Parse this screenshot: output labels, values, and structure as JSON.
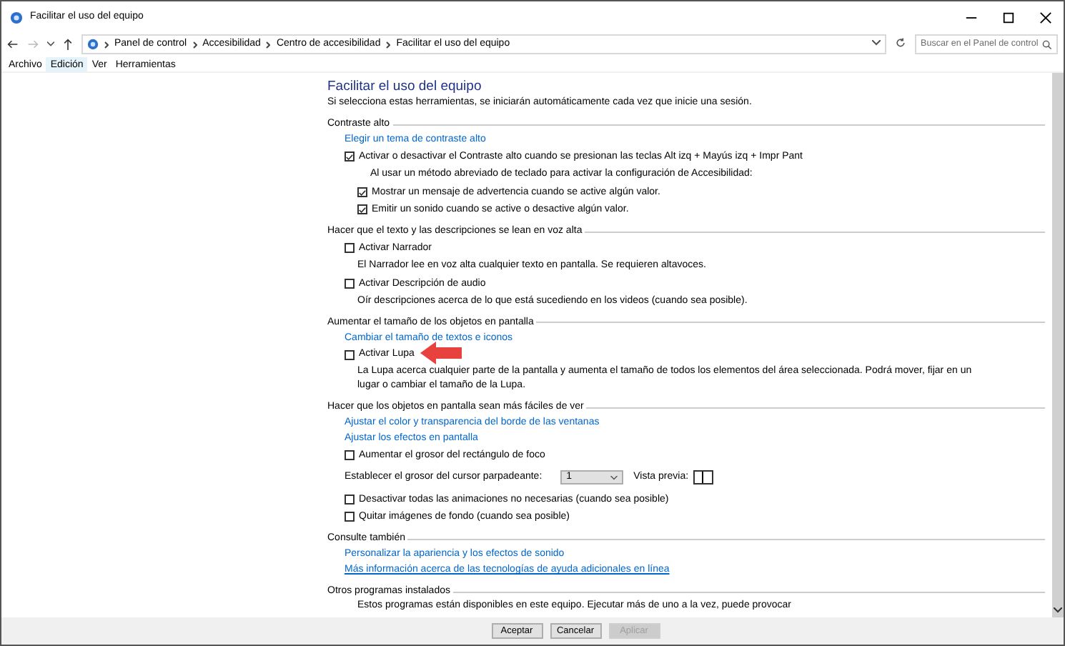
{
  "window": {
    "title": "Facilitar el uso del equipo"
  },
  "address": {
    "breadcrumb": [
      "Panel de control",
      "Accesibilidad",
      "Centro de accesibilidad",
      "Facilitar el uso del equipo"
    ],
    "search_placeholder": "Buscar en el Panel de control"
  },
  "menu": [
    {
      "label": "Archivo",
      "selected": false
    },
    {
      "label": "Edición",
      "selected": true
    },
    {
      "label": "Ver",
      "selected": false
    },
    {
      "label": "Herramientas",
      "selected": false
    }
  ],
  "page": {
    "title": "Facilitar el uso del equipo",
    "subtitle": "Si selecciona estas herramientas, se iniciarán automáticamente cada vez que inicie una sesión."
  },
  "sections": [
    {
      "heading": "Contraste alto",
      "items": [
        {
          "kind": "link",
          "label": "Elegir un tema de contraste alto"
        },
        {
          "kind": "check",
          "label": "Activar o desactivar el Contraste alto cuando se presionan las teclas Alt izq + Mayús izq + Impr Pant",
          "checked": true,
          "children": [
            {
              "kind": "text",
              "label": "Al usar un método abreviado de teclado para activar la configuración de Accesibilidad:"
            },
            {
              "kind": "check",
              "label": "Mostrar un mensaje de advertencia cuando se active algún valor.",
              "checked": true
            },
            {
              "kind": "check",
              "label": "Emitir un sonido cuando se active o desactive algún valor.",
              "checked": true
            }
          ]
        }
      ]
    },
    {
      "heading": "Hacer que el texto y las descripciones se lean en voz alta",
      "items": [
        {
          "kind": "check",
          "label": "Activar Narrador",
          "checked": false
        },
        {
          "kind": "text",
          "label": "El Narrador lee en voz alta cualquier texto en pantalla. Se requieren altavoces."
        },
        {
          "kind": "check",
          "label": "Activar Descripción de audio",
          "checked": false
        },
        {
          "kind": "text",
          "label": "Oír descripciones acerca de lo que está sucediendo en los videos (cuando sea posible)."
        }
      ]
    },
    {
      "heading": "Aumentar el tamaño de los objetos en pantalla",
      "items": [
        {
          "kind": "link",
          "label": "Cambiar el tamaño de textos e iconos"
        },
        {
          "kind": "check",
          "label": "Activar Lupa",
          "checked": false,
          "pointer": true
        },
        {
          "kind": "text",
          "label": "La Lupa acerca cualquier parte de la pantalla y aumenta el tamaño de todos los elementos del área seleccionada. Podrá mover, fijar en un lugar o cambiar el tamaño de la Lupa."
        }
      ]
    },
    {
      "heading": "Hacer que los objetos en pantalla sean más fáciles de ver",
      "items": [
        {
          "kind": "link",
          "label": "Ajustar el color y transparencia del borde de las ventanas"
        },
        {
          "kind": "link",
          "label": "Ajustar los efectos en pantalla"
        },
        {
          "kind": "check",
          "label": "Aumentar el grosor del rectángulo de foco",
          "checked": false
        },
        {
          "kind": "select",
          "label": "Establecer el grosor del cursor parpadeante:",
          "value": "1",
          "preview_label": "Vista previa:"
        },
        {
          "kind": "check",
          "label": "Desactivar todas las animaciones no necesarias (cuando sea posible)",
          "checked": false
        },
        {
          "kind": "check",
          "label": "Quitar imágenes de fondo (cuando sea posible)",
          "checked": false
        }
      ]
    },
    {
      "heading": "Consulte también",
      "items": [
        {
          "kind": "link",
          "label": "Personalizar la apariencia y los efectos de sonido"
        },
        {
          "kind": "link",
          "label": "Más información acerca de las tecnologías de ayuda adicionales en línea",
          "underlined": true
        }
      ]
    },
    {
      "heading": "Otros programas instalados",
      "items": [
        {
          "kind": "text",
          "label": "Estos programas están disponibles en este equipo. Ejecutar más de uno a la vez, puede provocar"
        }
      ]
    }
  ],
  "buttons": [
    {
      "label": "Aceptar",
      "disabled": false
    },
    {
      "label": "Cancelar",
      "disabled": false
    },
    {
      "label": "Aplicar",
      "disabled": true
    }
  ]
}
